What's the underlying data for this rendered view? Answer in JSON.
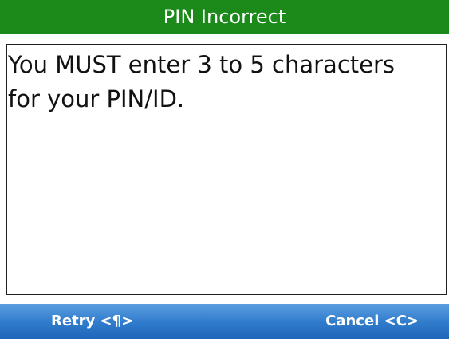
{
  "dialog": {
    "title": "PIN Incorrect",
    "message": "You MUST enter 3 to 5 characters\nfor your PIN/ID."
  },
  "softkeys": {
    "left_label": "Retry <¶>",
    "right_label": "Cancel <C>"
  },
  "colors": {
    "title_bar": "#1b8a1b",
    "softkey_bar": "#2f7acb"
  }
}
